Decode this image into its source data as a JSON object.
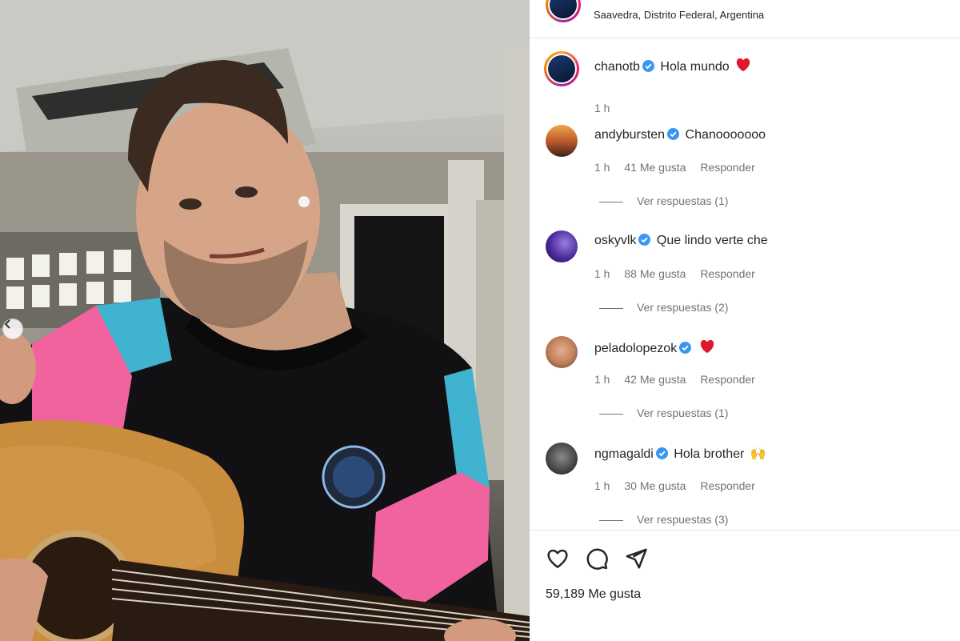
{
  "post": {
    "location": "Saavedra, Distrito Federal, Argentina",
    "likes": "59,189 Me gusta",
    "caption": {
      "username": "chanotb",
      "text": "Hola mundo",
      "emoji": "❤️",
      "time": "1 h"
    }
  },
  "comments": [
    {
      "username": "andybursten",
      "text": "Chanooooooo",
      "time": "1 h",
      "likes": "41 Me gusta",
      "reply": "Responder",
      "view_replies": "Ver respuestas (1)"
    },
    {
      "username": "oskyvlk",
      "text": "Que lindo verte che",
      "time": "1 h",
      "likes": "88 Me gusta",
      "reply": "Responder",
      "view_replies": "Ver respuestas (2)"
    },
    {
      "username": "peladolopezok",
      "text": "",
      "emoji": "❤️",
      "time": "1 h",
      "likes": "42 Me gusta",
      "reply": "Responder",
      "view_replies": "Ver respuestas (1)"
    },
    {
      "username": "ngmagaldi",
      "text": "Hola brother",
      "emoji": "🙌",
      "time": "1 h",
      "likes": "30 Me gusta",
      "reply": "Responder",
      "view_replies": "Ver respuestas (3)"
    }
  ],
  "icons": {
    "like": "heart-icon",
    "comment": "comment-bubble-icon",
    "share": "paper-plane-icon",
    "verified": "verified-badge-icon",
    "carousel_prev": "chevron-left-icon"
  },
  "colors": {
    "verified": "#3897f0",
    "heart": "#e0182d",
    "muted": "#737373"
  }
}
